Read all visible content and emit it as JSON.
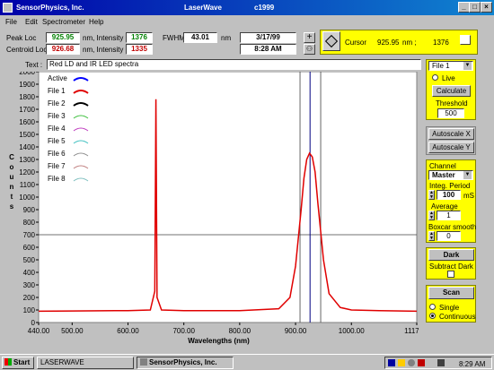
{
  "window": {
    "company": "SensorPhysics, Inc.",
    "app": "LaserWave",
    "copyright": "c1999"
  },
  "menu": [
    "File",
    "Edit",
    "Spectrometer",
    "Help"
  ],
  "header": {
    "peak_loc_label": "Peak Loc",
    "peak_loc": "925.95",
    "nm_intensity_label": "nm, Intensity",
    "peak_intensity": "1376",
    "centroid_loc_label": "Centroid Loc",
    "centroid_loc": "926.68",
    "centroid_intensity": "1335",
    "fwhm_label": "FWHM",
    "fwhm": "43.01",
    "fwhm_unit": "nm",
    "date": "3/17/99",
    "time": "8:28 AM"
  },
  "cursor": {
    "label": "Cursor",
    "position": "925.95",
    "unit": "nm ;",
    "intensity": "1376"
  },
  "text_field": {
    "label": "Text :",
    "value": "Red LD and IR LED spectra"
  },
  "legend": [
    {
      "name": "Active",
      "color": "#0000ff"
    },
    {
      "name": "File 1",
      "color": "#e00000"
    },
    {
      "name": "File 2",
      "color": "#000000"
    },
    {
      "name": "File 3",
      "color": "#40c040"
    },
    {
      "name": "File 4",
      "color": "#c040c0"
    },
    {
      "name": "File 5",
      "color": "#40c0c0"
    },
    {
      "name": "File 6",
      "color": "#909090"
    },
    {
      "name": "File 7",
      "color": "#c08080"
    },
    {
      "name": "File 8",
      "color": "#80c0c0"
    }
  ],
  "chart_data": {
    "type": "line",
    "ylabel": "Counts",
    "xlabel": "Wavelengths (nm)",
    "xlim": [
      440,
      1117
    ],
    "ylim": [
      0,
      2000
    ],
    "xticks": [
      "440.00",
      "500.00",
      "600.00",
      "700.00",
      "800.00",
      "900.00",
      "1000.00",
      "1117.00"
    ],
    "yticks": [
      "0",
      "100",
      "200",
      "300",
      "400",
      "500",
      "600",
      "700",
      "800",
      "900",
      "1000",
      "1100",
      "1200",
      "1300",
      "1400",
      "1500",
      "1600",
      "1700",
      "1800",
      "1900",
      "2000"
    ],
    "series": [
      {
        "name": "File 1",
        "x": [
          440,
          500,
          600,
          640,
          648,
          650,
          652,
          660,
          700,
          800,
          870,
          890,
          900,
          910,
          915,
          920,
          925,
          930,
          935,
          940,
          950,
          960,
          980,
          1000,
          1050,
          1117
        ],
        "y": [
          90,
          92,
          95,
          100,
          250,
          1780,
          200,
          100,
          95,
          95,
          110,
          200,
          450,
          900,
          1150,
          1300,
          1350,
          1320,
          1200,
          950,
          500,
          230,
          120,
          100,
          95,
          90
        ]
      }
    ],
    "cursor_x": 925.95,
    "crosshair_y": 700,
    "marker_lines_x": [
      908,
      945
    ]
  },
  "panel": {
    "file_select": "File 1",
    "live_label": "Live",
    "calculate": "Calculate",
    "threshold_label": "Threshold",
    "threshold": "500",
    "autoscale_x": "Autoscale X",
    "autoscale_y": "Autoscale Y",
    "channel_label": "Channel",
    "channel": "Master",
    "integ_label": "Integ. Period",
    "integ_value": "100",
    "integ_unit": "mS",
    "average_label": "Average",
    "average": "1",
    "boxcar_label": "Boxcar smooth",
    "boxcar": "0",
    "dark": "Dark",
    "subtract_dark": "Subtract Dark",
    "scan": "Scan",
    "single": "Single",
    "continuous": "Continuous"
  },
  "taskbar": {
    "start": "Start",
    "task1": "LASERWAVE",
    "task2": "SensorPhysics, Inc.",
    "clock": "8:29 AM"
  }
}
